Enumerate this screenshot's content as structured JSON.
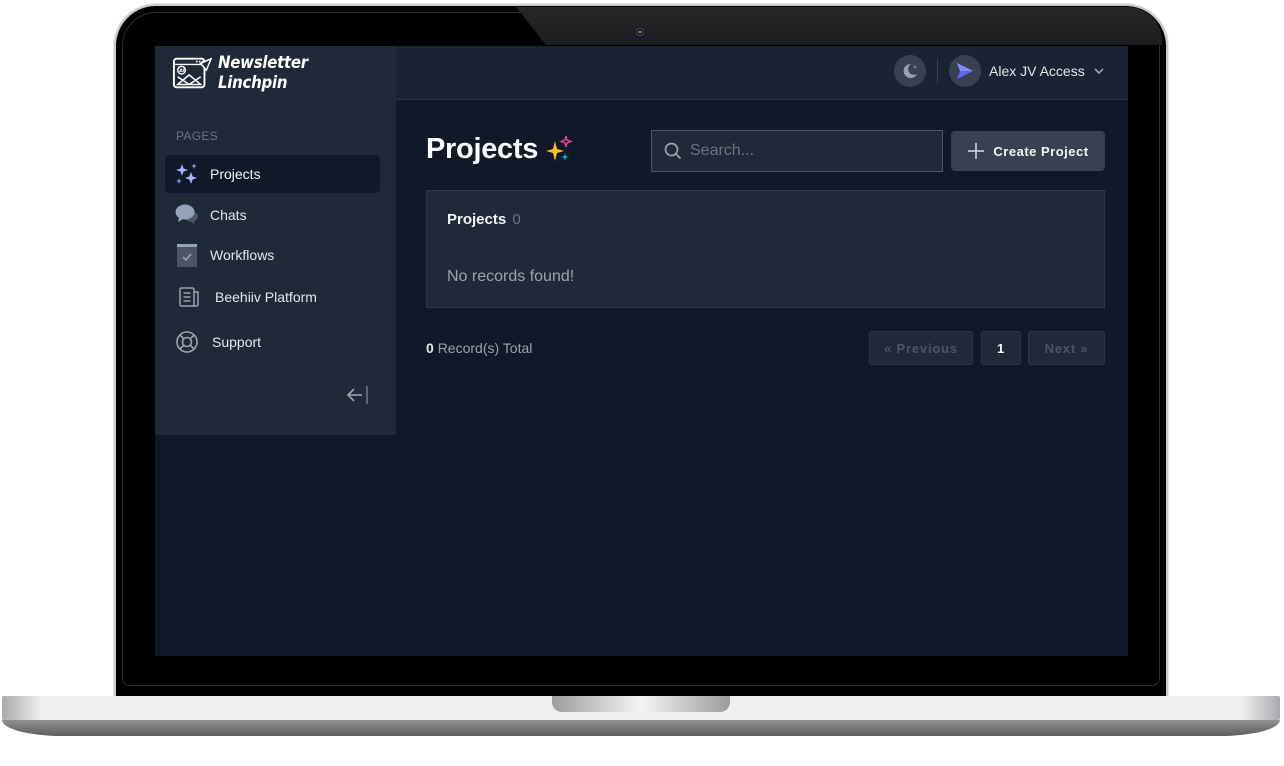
{
  "app": {
    "brand_name": "Newsletter Linchpin"
  },
  "sidebar": {
    "section_label": "PAGES",
    "items": [
      {
        "label": "Projects",
        "icon": "sparkles-icon",
        "active": true
      },
      {
        "label": "Chats",
        "icon": "chat-bubbles-icon",
        "active": false
      },
      {
        "label": "Workflows",
        "icon": "clipboard-check-icon",
        "active": false
      },
      {
        "label": "Beehiiv Platform",
        "icon": "newspaper-icon",
        "active": false
      },
      {
        "label": "Support",
        "icon": "lifebuoy-icon",
        "active": false
      }
    ],
    "collapse_icon": "arrow-left-bar-icon"
  },
  "topbar": {
    "theme_icon": "moon-icon",
    "user_name": "Alex JV Access",
    "user_avatar_icon": "paper-plane-icon"
  },
  "main": {
    "title": "Projects",
    "title_icon": "sparkles-icon",
    "search": {
      "placeholder": "Search...",
      "value": ""
    },
    "create_button_label": "Create Project",
    "card": {
      "title": "Projects",
      "count": "0",
      "empty_message": "No records found!"
    },
    "records": {
      "count": "0",
      "label": "Record(s) Total"
    },
    "pagination": {
      "previous_label": "« Previous",
      "current_page": "1",
      "next_label": "Next »"
    }
  },
  "colors": {
    "accent": "#818cf8",
    "background": "#111827",
    "panel": "#1f2937",
    "sparkle_yellow": "#fbbf24",
    "sparkle_pink": "#ec4899",
    "sparkle_cyan": "#06b6d4"
  }
}
